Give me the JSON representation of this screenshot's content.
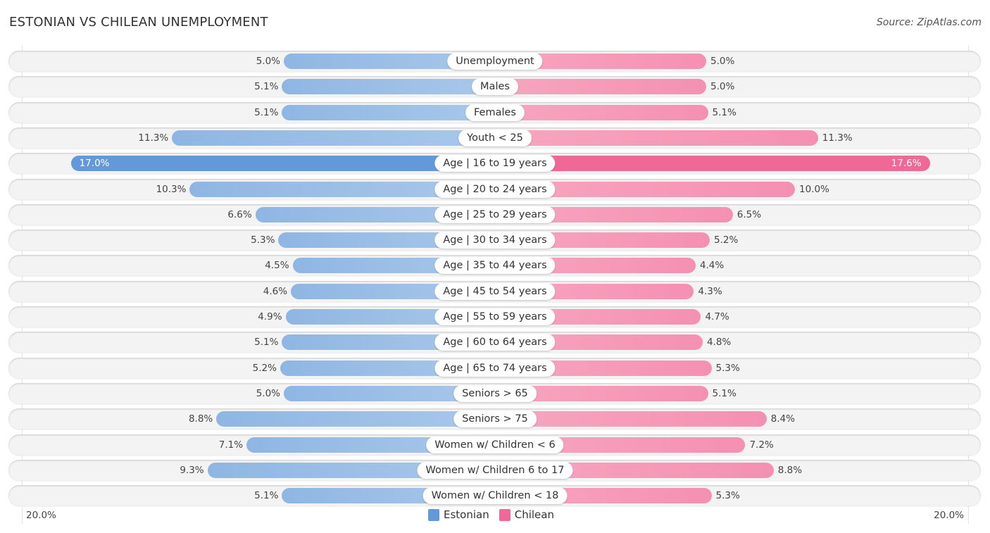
{
  "title": "ESTONIAN VS CHILEAN UNEMPLOYMENT",
  "source": "Source: ZipAtlas.com",
  "colors": {
    "estonian": "#6399d8",
    "chilean": "#f06895"
  },
  "chart_data": {
    "type": "bar",
    "orientation": "horizontal-diverging",
    "title": "ESTONIAN VS CHILEAN UNEMPLOYMENT",
    "xlabel": "",
    "ylabel": "",
    "axis_range": [
      0,
      20.0
    ],
    "axis_labels": {
      "left": "20.0%",
      "right": "20.0%"
    },
    "legend": {
      "position": "bottom-center",
      "entries": [
        "Estonian",
        "Chilean"
      ]
    },
    "categories": [
      "Unemployment",
      "Males",
      "Females",
      "Youth < 25",
      "Age | 16 to 19 years",
      "Age | 20 to 24 years",
      "Age | 25 to 29 years",
      "Age | 30 to 34 years",
      "Age | 35 to 44 years",
      "Age | 45 to 54 years",
      "Age | 55 to 59 years",
      "Age | 60 to 64 years",
      "Age | 65 to 74 years",
      "Seniors > 65",
      "Seniors > 75",
      "Women w/ Children < 6",
      "Women w/ Children 6 to 17",
      "Women w/ Children < 18"
    ],
    "series": [
      {
        "name": "Estonian",
        "values": [
          5.0,
          5.1,
          5.1,
          11.3,
          17.0,
          10.3,
          6.6,
          5.3,
          4.5,
          4.6,
          4.9,
          5.1,
          5.2,
          5.0,
          8.8,
          7.1,
          9.3,
          5.1
        ]
      },
      {
        "name": "Chilean",
        "values": [
          5.0,
          5.0,
          5.1,
          11.3,
          17.6,
          10.0,
          6.5,
          5.2,
          4.4,
          4.3,
          4.7,
          4.8,
          5.3,
          5.1,
          8.4,
          7.2,
          8.8,
          5.3
        ]
      }
    ],
    "value_suffix": "%",
    "highlighted_category": "Age | 16 to 19 years"
  }
}
